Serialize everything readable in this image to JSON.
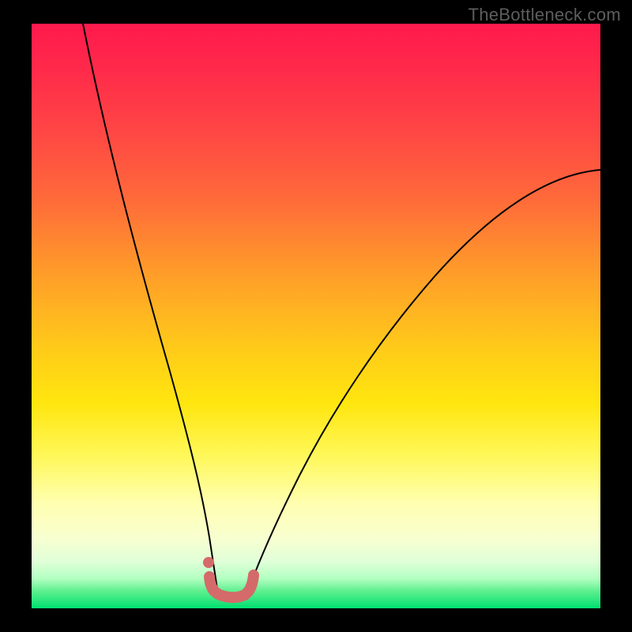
{
  "watermark": "TheBottleneck.com",
  "chart_data": {
    "type": "line",
    "title": "",
    "xlabel": "",
    "ylabel": "",
    "xlim": [
      0,
      100
    ],
    "ylim": [
      0,
      100
    ],
    "series": [
      {
        "name": "left-branch",
        "x": [
          9,
          12,
          16,
          20,
          24,
          27,
          29,
          31,
          32.5
        ],
        "y": [
          100,
          82,
          62,
          44,
          28,
          17,
          10,
          5,
          2
        ]
      },
      {
        "name": "right-branch",
        "x": [
          38,
          41,
          46,
          52,
          60,
          70,
          82,
          94,
          100
        ],
        "y": [
          2,
          6,
          13,
          22,
          34,
          48,
          60,
          70,
          75
        ]
      }
    ],
    "floor_segment": {
      "name": "valley-floor",
      "x": [
        32.5,
        38
      ],
      "y": [
        2,
        2
      ]
    },
    "markers": [
      {
        "name": "floor-dot",
        "x": 31,
        "y": 7
      }
    ],
    "gradient_stops": [
      {
        "pos": 0,
        "color": "#ff1a4d"
      },
      {
        "pos": 40,
        "color": "#ff9a2a"
      },
      {
        "pos": 70,
        "color": "#ffe60f"
      },
      {
        "pos": 90,
        "color": "#f0ffcc"
      },
      {
        "pos": 100,
        "color": "#00e070"
      }
    ]
  }
}
